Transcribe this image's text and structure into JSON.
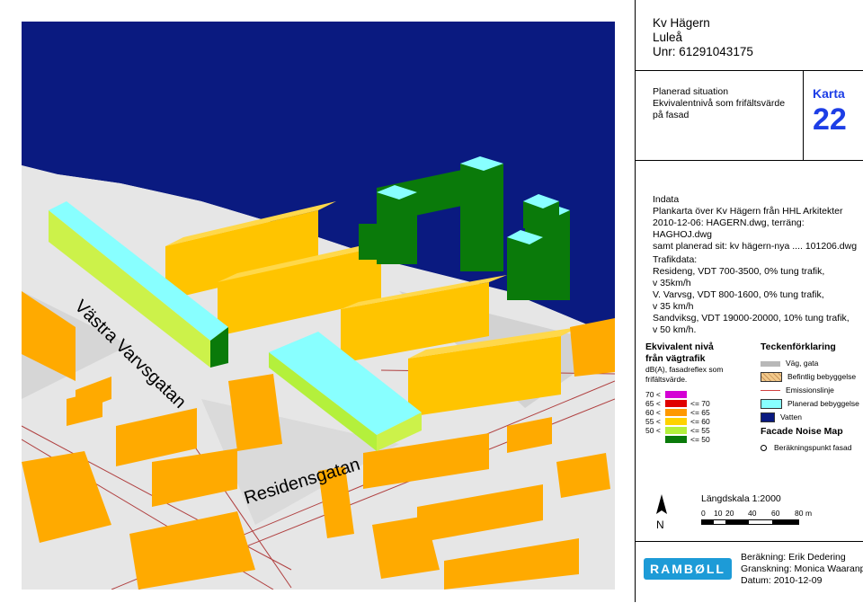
{
  "map": {
    "street_1": "Västra Varvsgatan",
    "street_2": "Residensgatan"
  },
  "header": {
    "line1": "Kv Hägern",
    "line2": "Luleå",
    "line3": "Unr: 61291043175"
  },
  "situation": {
    "line1": "Planerad situation",
    "line2": "Ekvivalentnivå som frifältsvärde",
    "line3": "på fasad"
  },
  "karta": {
    "label": "Karta",
    "number": "22"
  },
  "indata": {
    "title": "Indata",
    "line1": "Plankarta över Kv Hägern från HHL Arkitekter",
    "line2": "2010-12-06: HAGERN.dwg, terräng: HAGHOJ.dwg",
    "line3": "samt planerad sit: kv hägern-nya .... 101206.dwg"
  },
  "trafikdata": {
    "title": "Trafikdata:",
    "line1": "Resideng, VDT 700-3500, 0% tung trafik,",
    "line2": "v 35km/h",
    "line3": "V. Varvsg, VDT 800-1600, 0% tung trafik,",
    "line4": "v 35 km/h",
    "line5": "Sandviksg, VDT 19000-20000, 10% tung trafik,",
    "line6": "v 50 km/h."
  },
  "noise_legend": {
    "title1": "Ekvivalent nivå",
    "title2": "från vägtrafik",
    "sub1": "dB(A), fasadreflex som",
    "sub2": "frifältsvärde.",
    "classes": [
      {
        "low": "70 <",
        "high": "",
        "color": "#d400d4"
      },
      {
        "low": "65 <",
        "high": "<= 70",
        "color": "#e00000"
      },
      {
        "low": "60 <",
        "high": "<= 65",
        "color": "#ff9900"
      },
      {
        "low": "55 <",
        "high": "<= 60",
        "color": "#ffd200"
      },
      {
        "low": "50 <",
        "high": "<= 55",
        "color": "#b4f03c"
      },
      {
        "low": "",
        "high": "<= 50",
        "color": "#0a7a0a"
      }
    ]
  },
  "symbols": {
    "title": "Teckenförklaring",
    "road": "Väg, gata",
    "existing": "Befintlig bebyggelse",
    "emission": "Emissionslinje",
    "planned": "Planerad bebyggelse",
    "water": "Vatten",
    "facade_title": "Facade Noise Map",
    "calc_point": "Beräkningspunkt fasad",
    "colors": {
      "road": "#b8b8b8",
      "existing": "#f2c98a",
      "emission": "#d04040",
      "planned": "#8ff",
      "water": "#0a1a80"
    }
  },
  "scale": {
    "title": "Längdskala 1:2000",
    "ticks": [
      "0",
      "10",
      "20",
      "40",
      "60",
      "80"
    ],
    "unit": "m",
    "north": "N"
  },
  "footer": {
    "logo": "RAMBØLL",
    "calc": "Beräkning: Erik Dedering",
    "review": "Granskning: Monica Waaranperä",
    "date": "Datum: 2010-12-09"
  }
}
